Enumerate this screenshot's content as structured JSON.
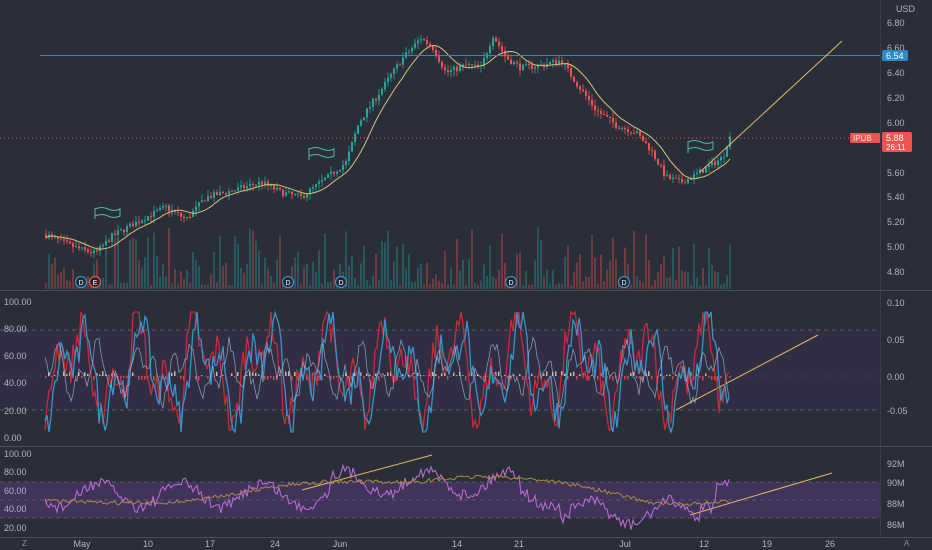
{
  "currency": "USD",
  "colors": {
    "background": "#2a2e39",
    "up": "#26a69a",
    "down": "#ef5350",
    "ma": "#d8c27a",
    "trendline": "#e3b95f",
    "horizontal_line": "#2f88c8",
    "rsi_line": "#b86ad1",
    "rsi_band": "#7e57c2",
    "stoch_k": "#3d93c9",
    "stoch_d": "#c62c3a"
  },
  "price_axis": {
    "ticks": [
      "6.80",
      "6.60",
      "6.40",
      "6.20",
      "6.00",
      "5.80",
      "5.60",
      "5.40",
      "5.20",
      "5.00",
      "4.80"
    ],
    "horizontal_line_label": "6.54",
    "price_ticker": "IPUB",
    "price_label": "5.88",
    "countdown": "26:11"
  },
  "oscillator_axis": {
    "left_ticks": [
      "100.00",
      "80.00",
      "60.00",
      "40.00",
      "20.00",
      "0.00"
    ],
    "right_ticks": [
      "0.10",
      "0.05",
      "0.00",
      "-0.05"
    ]
  },
  "rsi_axis": {
    "left_ticks": [
      "100.00",
      "80.00",
      "60.00",
      "40.00",
      "20.00"
    ],
    "right_ticks": [
      "92M",
      "90M",
      "88M",
      "86M"
    ]
  },
  "time_axis": {
    "labels": [
      "May",
      "10",
      "17",
      "24",
      "Jun",
      "14",
      "21",
      "Jul",
      "12",
      "19",
      "26"
    ],
    "corner_left": "Z",
    "corner_right": "A"
  },
  "event_markers": [
    "D",
    "E",
    "D",
    "D",
    "D",
    "D"
  ],
  "chart_data": [
    {
      "type": "candlestick",
      "x": [
        "May",
        "10",
        "17",
        "24",
        "Jun",
        "14",
        "21",
        "Jul",
        "12"
      ],
      "y_approx": [
        5.05,
        5.25,
        5.35,
        5.45,
        6.1,
        6.5,
        6.45,
        5.55,
        5.88
      ],
      "last_price": 5.88,
      "horizontal_line": 6.54,
      "ylim": [
        4.75,
        6.88
      ],
      "overlays": [
        "moving-average",
        "volume-bars",
        "trendline"
      ]
    },
    {
      "type": "line",
      "ylim": [
        0,
        100
      ],
      "levels": [
        80,
        20
      ],
      "right_axis_ylim": [
        -0.05,
        0.1
      ],
      "series_count": 3
    },
    {
      "type": "line",
      "ylim": [
        20,
        100
      ],
      "band": [
        40,
        70
      ],
      "right_axis_ylim": [
        86000000,
        92000000
      ],
      "series_count": 2
    }
  ]
}
